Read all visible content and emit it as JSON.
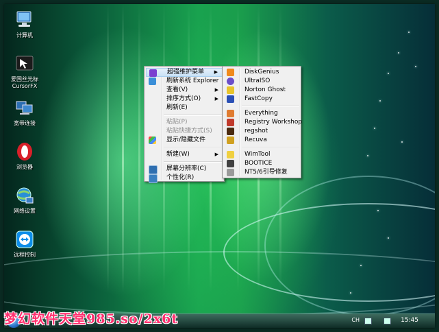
{
  "desktop": {
    "icons": [
      {
        "label": "计算机",
        "icon": "computer-icon"
      },
      {
        "label": "爱国丝光标\nCursorFX",
        "icon": "cursorfx-icon",
        "badge": "CursorFX"
      },
      {
        "label": "宽带连接",
        "icon": "broadband-icon"
      },
      {
        "label": "浏览器",
        "icon": "opera-icon"
      },
      {
        "label": "网络设置",
        "icon": "network-icon"
      },
      {
        "label": "远程控制",
        "icon": "teamviewer-icon"
      }
    ]
  },
  "context_menu": {
    "items": [
      {
        "label": "超强维护菜单",
        "submenu": true,
        "highlighted": true
      },
      {
        "label": "刷新系统 Explorer"
      },
      {
        "label": "查看(V)",
        "submenu": true
      },
      {
        "label": "排序方式(O)",
        "submenu": true
      },
      {
        "label": "刷新(E)"
      },
      {
        "label": "粘贴(P)",
        "disabled": true
      },
      {
        "label": "粘贴快捷方式(S)",
        "disabled": true
      },
      {
        "label": "显示/隐藏文件"
      },
      {
        "label": "新建(W)",
        "submenu": true
      },
      {
        "label": "屏幕分辨率(C)"
      },
      {
        "label": "个性化(R)"
      }
    ]
  },
  "submenu": {
    "items": [
      {
        "label": "DiskGenius",
        "color": "#f08a1c"
      },
      {
        "label": "UltraISO",
        "color": "#6b4ec9"
      },
      {
        "label": "Norton Ghost",
        "color": "#e8c42a"
      },
      {
        "label": "FastCopy",
        "color": "#2a4fb5"
      },
      {
        "label": "Everything",
        "color": "#e07b30"
      },
      {
        "label": "Registry Workshop",
        "color": "#c0392b"
      },
      {
        "label": "regshot",
        "color": "#4a2a10"
      },
      {
        "label": "Recuva",
        "color": "#d0a020"
      },
      {
        "label": "WimTool",
        "color": "#f0d040"
      },
      {
        "label": "BOOTICE",
        "color": "#404040"
      },
      {
        "label": "NT5/6引导修复",
        "color": "#9a9a9a"
      }
    ]
  },
  "taskbar": {
    "lang": "CH",
    "clock": "15:45"
  },
  "watermark": "梦幻软件天堂985.so/2x6t"
}
